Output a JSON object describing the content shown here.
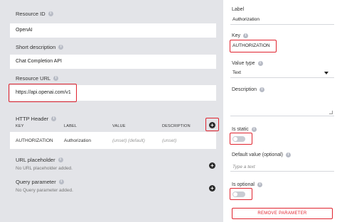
{
  "left": {
    "resource_id": {
      "label": "Resource ID",
      "value": "OpenAI"
    },
    "short_description": {
      "label": "Short description",
      "value": "Chat Completion API"
    },
    "resource_url": {
      "label": "Resource URL",
      "value": "https://api.openai.com/v1"
    },
    "http_header": {
      "label": "HTTP Header",
      "columns": [
        "KEY",
        "LABEL",
        "VALUE",
        "DESCRIPTION"
      ],
      "rows": [
        {
          "key": "AUTHORIZATION",
          "label": "Authorization",
          "value": "(unset) (default)",
          "description": "(unset)"
        }
      ]
    },
    "url_placeholder": {
      "label": "URL placeholder",
      "empty": "No URL placeholder added."
    },
    "query_parameter": {
      "label": "Query parameter",
      "empty": "No Query parameter added."
    }
  },
  "right": {
    "label_field": {
      "label": "Label",
      "value": "Authorization"
    },
    "key_field": {
      "label": "Key",
      "value": "AUTHORIZATION"
    },
    "value_type": {
      "label": "Value type",
      "value": "Text"
    },
    "description": {
      "label": "Description",
      "value": ""
    },
    "is_static": {
      "label": "Is static",
      "on": false
    },
    "default_value": {
      "label": "Default value (optional)",
      "placeholder": "Type a text"
    },
    "is_optional": {
      "label": "Is optional",
      "on": false
    },
    "remove_button": "REMOVE PARAMETER"
  },
  "colors": {
    "highlight": "#e0232e",
    "panel_bg": "#e3e4e8"
  },
  "icons": {
    "info": "info-icon",
    "add": "plus-circle-icon",
    "caret": "chevron-down-icon"
  }
}
